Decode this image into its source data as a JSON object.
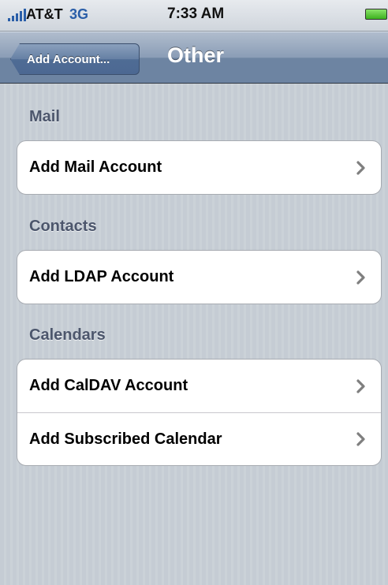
{
  "status_bar": {
    "carrier": "AT&T",
    "network": "3G",
    "time": "7:33 AM",
    "signal_icon": "signal-bars-icon",
    "battery_icon": "battery-icon"
  },
  "nav": {
    "back_label": "Add Account...",
    "title": "Other"
  },
  "sections": [
    {
      "header": "Mail",
      "items": [
        {
          "label": "Add Mail Account",
          "icon": "chevron-right-icon"
        }
      ]
    },
    {
      "header": "Contacts",
      "items": [
        {
          "label": "Add LDAP Account",
          "icon": "chevron-right-icon"
        }
      ]
    },
    {
      "header": "Calendars",
      "items": [
        {
          "label": "Add CalDAV Account",
          "icon": "chevron-right-icon"
        },
        {
          "label": "Add Subscribed Calendar",
          "icon": "chevron-right-icon"
        }
      ]
    }
  ],
  "colors": {
    "background": "#c5ccd4",
    "navbar": "#6d84a2",
    "section_header": "#4c566c",
    "network": "#2a5ea8"
  }
}
